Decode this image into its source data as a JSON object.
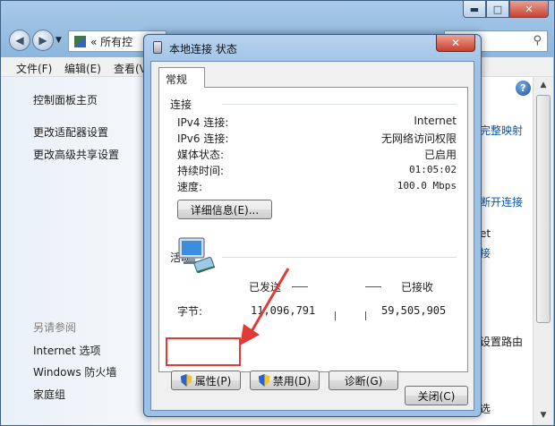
{
  "explorer": {
    "address_text": "« 所有控",
    "menu": [
      "文件(F)",
      "编辑(E)",
      "查看(V"
    ],
    "left_links": [
      "控制面板主页",
      "更改适配器设置",
      "更改高级共享设置"
    ],
    "see_also_heading": "另请参阅",
    "see_also_links": [
      "Internet 选项",
      "Windows 防火墙",
      "家庭组"
    ],
    "right_fragments": {
      "mapping": "完整映射",
      "disconnect": "断开连接",
      "net": "et",
      "access": "接",
      "routing": "设置路由",
      "choose": "选"
    }
  },
  "dialog": {
    "title": "本地连接 状态",
    "close_glyph": "✕",
    "tab": "常规",
    "connection": {
      "heading": "连接",
      "rows": [
        {
          "label": "IPv4 连接:",
          "value": "Internet"
        },
        {
          "label": "IPv6 连接:",
          "value": "无网络访问权限"
        },
        {
          "label": "媒体状态:",
          "value": "已启用"
        },
        {
          "label": "持续时间:",
          "value": "01:05:02"
        },
        {
          "label": "速度:",
          "value": "100.0 Mbps"
        }
      ],
      "details_button": "详细信息(E)..."
    },
    "activity": {
      "heading": "活动",
      "sent_label": "已发送",
      "received_label": "已接收",
      "bytes_label": "字节:",
      "bytes_sent": "11,096,791",
      "bytes_received": "59,505,905"
    },
    "buttons": {
      "properties": "属性(P)",
      "disable": "禁用(D)",
      "diagnose": "诊断(G)",
      "close": "关闭(C)"
    }
  },
  "annotation_color": "#e23a37"
}
